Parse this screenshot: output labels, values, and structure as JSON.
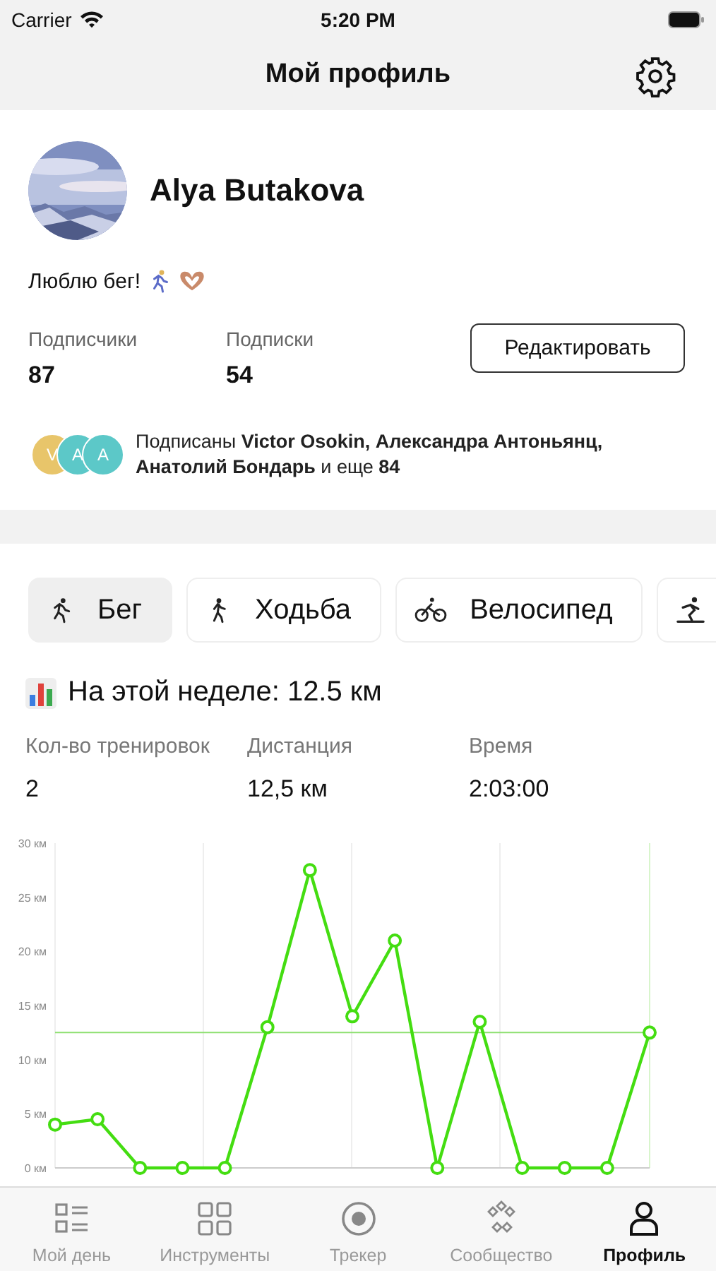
{
  "status_bar": {
    "carrier": "Carrier",
    "time": "5:20 PM"
  },
  "nav": {
    "title": "Мой профиль"
  },
  "profile": {
    "name": "Alya Butakova",
    "bio": "Люблю бег!",
    "counters": [
      {
        "label": "Подписчики",
        "value": "87"
      },
      {
        "label": "Подписки",
        "value": "54"
      }
    ],
    "edit_button": "Редактировать",
    "followers": {
      "avatars": [
        {
          "letter": "V",
          "color": "#e8c56a"
        },
        {
          "letter": "A",
          "color": "#5cc8c8"
        },
        {
          "letter": "A",
          "color": "#5cc8c8"
        }
      ],
      "text": "Подписаны **Victor Osokin, Александра Антоньянц, Анатолий Бондарь** и еще **84**"
    }
  },
  "activities": [
    {
      "kind": "run",
      "label": "Бег",
      "selected": true
    },
    {
      "kind": "walk",
      "label": "Ходьба",
      "selected": false
    },
    {
      "kind": "bike",
      "label": "Велосипед",
      "selected": false
    },
    {
      "kind": "ski",
      "selected": false
    }
  ],
  "week": {
    "title": "На этой неделе: 12.5 км",
    "stats": [
      {
        "label": "Кол-во тренировок",
        "value": "2"
      },
      {
        "label": "Дистанция",
        "value": "12,5 км"
      },
      {
        "label": "Время",
        "value": "2:03:00"
      }
    ],
    "chart_data": {
      "type": "line",
      "series": [
        {
          "color": "#44dd11",
          "marker": "circle",
          "values": [
            4,
            4.5,
            0,
            0,
            0,
            13,
            27.5,
            14,
            21,
            0,
            13.5,
            0,
            0,
            0,
            12.5
          ]
        }
      ],
      "ylim": [
        0,
        30
      ],
      "yticks": [
        {
          "value": 0,
          "label": "0 км"
        },
        {
          "value": 5,
          "label": "5 км"
        },
        {
          "value": 10,
          "label": "10 км"
        },
        {
          "value": 15,
          "label": "15 км"
        },
        {
          "value": 20,
          "label": "20 км"
        },
        {
          "value": 25,
          "label": "25 км"
        },
        {
          "value": 30,
          "label": "30 км"
        }
      ],
      "ref_lines": [
        {
          "axis": "y",
          "value": 12.5
        }
      ]
    }
  },
  "tab_bar": [
    {
      "kind": "day",
      "label": "Мой день",
      "selected": false
    },
    {
      "kind": "tools",
      "label": "Инструменты",
      "selected": false
    },
    {
      "kind": "tracker",
      "label": "Трекер",
      "selected": false
    },
    {
      "kind": "community",
      "label": "Сообщество",
      "selected": false
    },
    {
      "kind": "profile",
      "label": "Профиль",
      "selected": true
    }
  ]
}
